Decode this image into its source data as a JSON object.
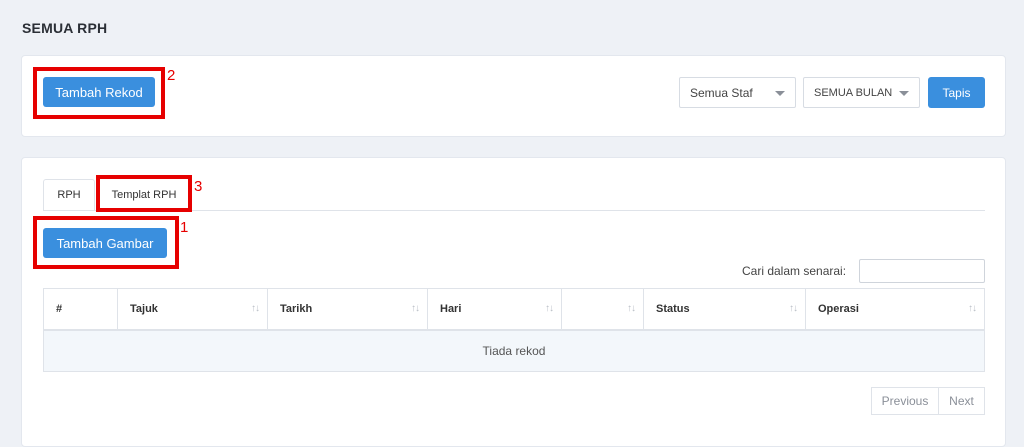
{
  "page": {
    "title": "SEMUA RPH"
  },
  "toolbar": {
    "add_record_label": "Tambah Rekod",
    "staff_filter": {
      "selected": "Semua Staf"
    },
    "month_filter": {
      "selected": "SEMUA BULAN"
    },
    "filter_button_label": "Tapis"
  },
  "tabs": [
    {
      "label": "RPH",
      "active": true
    },
    {
      "label": "Templat RPH",
      "active": false
    }
  ],
  "add_image_label": "Tambah Gambar",
  "search": {
    "label": "Cari dalam senarai:",
    "value": ""
  },
  "table": {
    "columns": [
      "#",
      "Tajuk",
      "Tarikh",
      "Hari",
      "",
      "Status",
      "Operasi"
    ],
    "empty_text": "Tiada rekod"
  },
  "pagination": {
    "previous": "Previous",
    "next": "Next"
  },
  "annotations": [
    {
      "number": "1"
    },
    {
      "number": "2"
    },
    {
      "number": "3"
    }
  ],
  "colors": {
    "accent": "#3a8fde",
    "callout": "#e60000",
    "background": "#eef1f6"
  },
  "icons": {
    "sort": "sort-arrows-icon",
    "caret": "caret-down-icon"
  }
}
